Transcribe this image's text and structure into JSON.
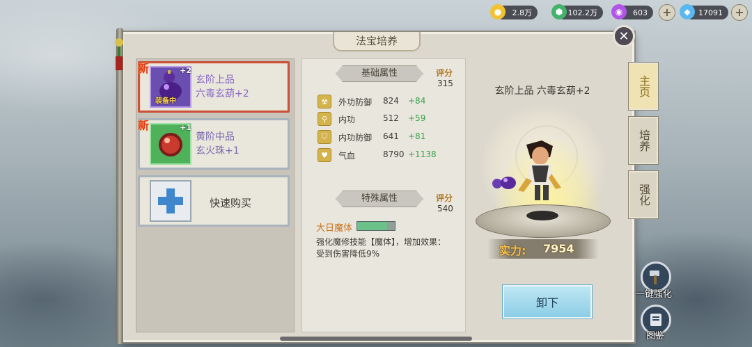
{
  "resources": [
    {
      "icon": "gold-coin-icon",
      "value": "2.8万",
      "color": "#f2c230"
    },
    {
      "icon": "jade-icon",
      "value": "102.2万",
      "color": "#43b36b"
    },
    {
      "icon": "purple-orb-icon",
      "value": "603",
      "color": "#b055e8"
    },
    {
      "icon": "diamond-icon",
      "value": "17091",
      "color": "#5ab8f0"
    }
  ],
  "panel": {
    "title": "法宝培养",
    "close_icon": "crossed-swords-icon"
  },
  "items": [
    {
      "name_line1": "玄阶上品",
      "name_line2": "六毒玄葫+2",
      "level": "+2",
      "badge": "新",
      "status": "装备中",
      "selected": true,
      "icon": "gourd-icon"
    },
    {
      "name_line1": "黄阶中品",
      "name_line2": "玄火珠+1",
      "level": "+1",
      "badge": "新",
      "selected": false,
      "icon": "fire-pearl-icon"
    }
  ],
  "quick_buy": {
    "label": "快速购买",
    "icon": "plus-icon"
  },
  "basic": {
    "title": "基础属性",
    "score_label": "评分",
    "score": "315",
    "attrs": [
      {
        "icon": "armor-icon",
        "name": "外功防御",
        "value": "824",
        "add": "+84"
      },
      {
        "icon": "magnify-icon",
        "name": "内功",
        "value": "512",
        "add": "+59"
      },
      {
        "icon": "shield-icon",
        "name": "内功防御",
        "value": "641",
        "add": "+81"
      },
      {
        "icon": "heart-icon",
        "name": "气血",
        "value": "8790",
        "add": "+1138"
      }
    ]
  },
  "special": {
    "title": "特殊属性",
    "score_label": "评分",
    "score": "540",
    "name": "大日魔体",
    "progress": 0.8,
    "desc": "强化魔修技能【魔体】，增加效果：受到伤害降低9%"
  },
  "equipment": {
    "title": "玄阶上品 六毒玄葫+2",
    "power_label": "实力:",
    "power": "7954",
    "unequip_label": "卸下"
  },
  "tabs": [
    {
      "label": "主页",
      "active": true
    },
    {
      "label": "培养",
      "active": false
    },
    {
      "label": "强化",
      "active": false
    }
  ],
  "side_buttons": [
    {
      "label": "一键强化",
      "icon": "hammer-icon"
    },
    {
      "label": "图鉴",
      "icon": "book-icon"
    }
  ]
}
